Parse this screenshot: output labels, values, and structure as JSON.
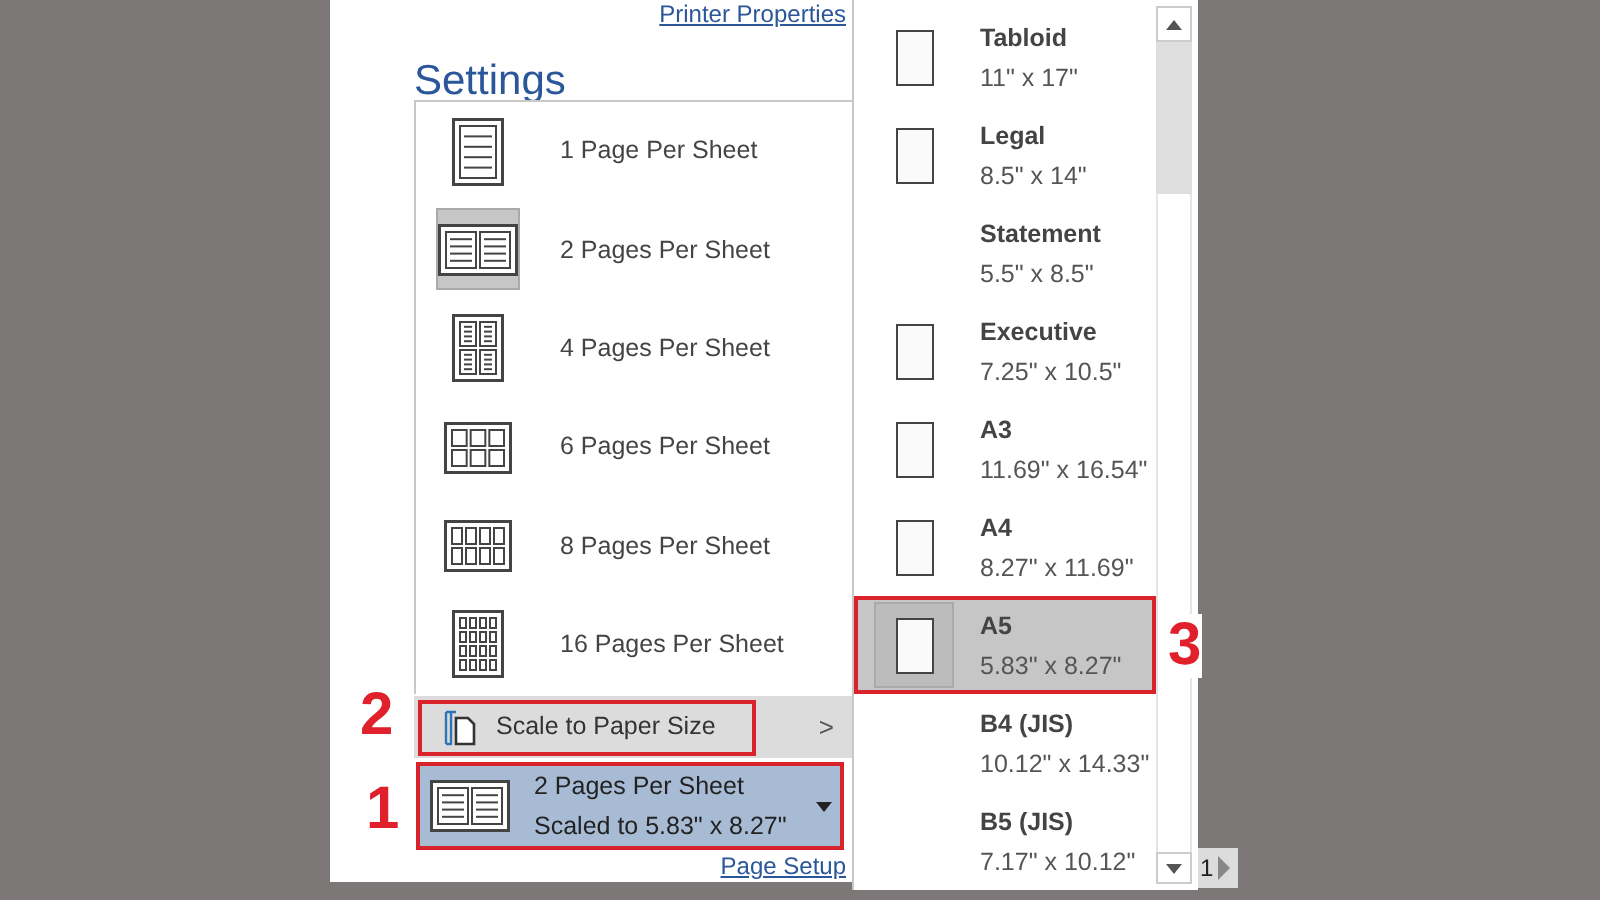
{
  "print_panel": {
    "printer_properties_link": "Printer Properties",
    "heading": "Settings",
    "page_setup_link": "Page Setup"
  },
  "pages_per_sheet_menu": {
    "items": [
      {
        "label": "1 Page Per Sheet",
        "kind": "one",
        "selected": false
      },
      {
        "label": "2 Pages Per Sheet",
        "kind": "two",
        "selected": true
      },
      {
        "label": "4 Pages Per Sheet",
        "kind": "four",
        "selected": false
      },
      {
        "label": "6 Pages Per Sheet",
        "kind": "six",
        "selected": false
      },
      {
        "label": "8 Pages Per Sheet",
        "kind": "eight",
        "selected": false
      },
      {
        "label": "16 Pages Per Sheet",
        "kind": "sixteen",
        "selected": false
      }
    ],
    "scale_item": {
      "label": "Scale to Paper Size",
      "chevron": ">"
    }
  },
  "pages_per_sheet_dropdown": {
    "title": "2 Pages Per Sheet",
    "subtitle": "Scaled to 5.83\" x 8.27\""
  },
  "paper_size_menu": {
    "items": [
      {
        "name": "Tabloid",
        "size": "11\" x 17\"",
        "has_icon": true,
        "selected": false
      },
      {
        "name": "Legal",
        "size": "8.5\" x 14\"",
        "has_icon": true,
        "selected": false
      },
      {
        "name": "Statement",
        "size": "5.5\" x 8.5\"",
        "has_icon": false,
        "selected": false
      },
      {
        "name": "Executive",
        "size": "7.25\" x 10.5\"",
        "has_icon": true,
        "selected": false
      },
      {
        "name": "A3",
        "size": "11.69\" x 16.54\"",
        "has_icon": true,
        "selected": false
      },
      {
        "name": "A4",
        "size": "8.27\" x 11.69\"",
        "has_icon": true,
        "selected": false
      },
      {
        "name": "A5",
        "size": "5.83\" x 8.27\"",
        "has_icon": true,
        "selected": true
      },
      {
        "name": "B4 (JIS)",
        "size": "10.12\" x 14.33\"",
        "has_icon": false,
        "selected": false
      },
      {
        "name": "B5 (JIS)",
        "size": "7.17\" x 10.12\"",
        "has_icon": false,
        "selected": false
      }
    ]
  },
  "callouts": [
    {
      "label": "2"
    },
    {
      "label": "1"
    },
    {
      "label": "3"
    }
  ],
  "page_nav": {
    "page": "1"
  }
}
